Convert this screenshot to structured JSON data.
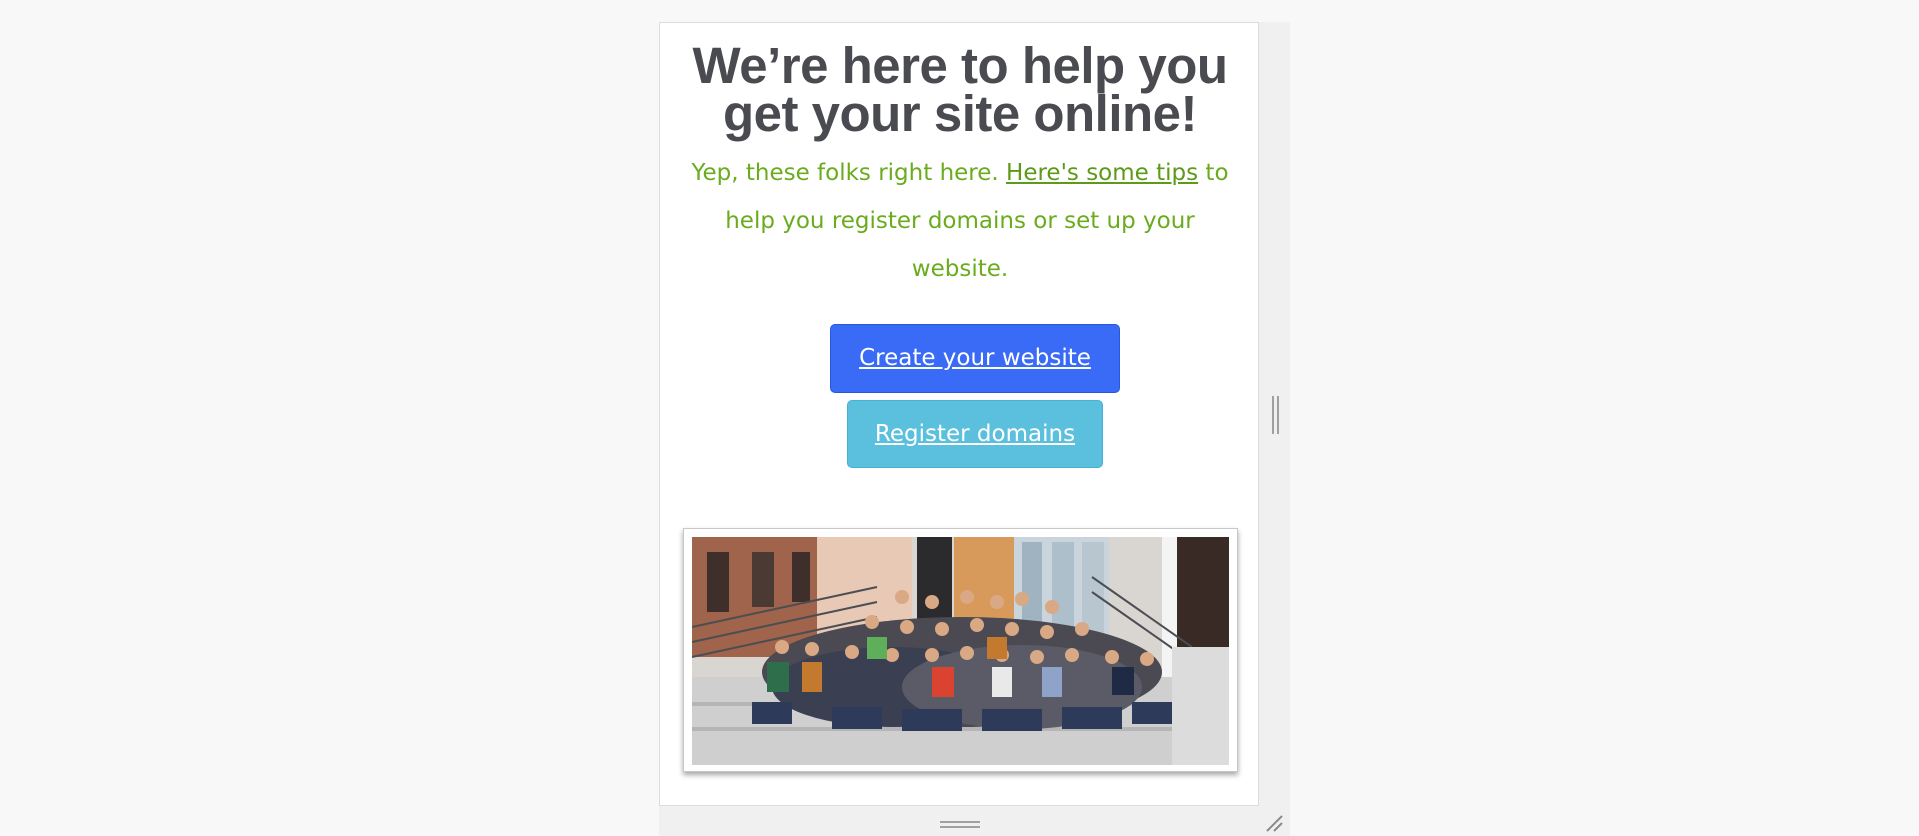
{
  "hero": {
    "headline_line1": "We’re here to help you",
    "headline_line2": "get your site online!",
    "intro_before_link": "Yep, these folks right here. ",
    "intro_link": "Here's some tips",
    "intro_after_link": " to help you register domains or set up your website."
  },
  "buttons": {
    "create_website": "Create your website",
    "register_domains": "Register domains"
  },
  "colors": {
    "headline": "#4a4b50",
    "intro_text": "#6aac1e",
    "primary_button": "#3a6bf6",
    "info_button": "#5bc0de"
  },
  "image": {
    "alt": "Team photo"
  },
  "icons": {
    "resize_right": "vertical-resize-grip-icon",
    "resize_bottom": "horizontal-resize-grip-icon",
    "resize_corner": "corner-resize-grip-icon"
  }
}
